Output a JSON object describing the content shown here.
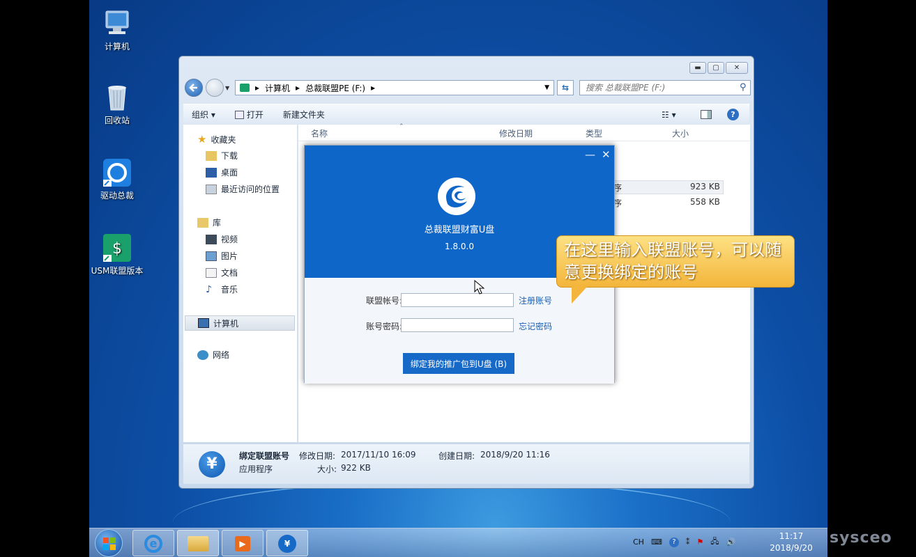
{
  "desktop": {
    "icons": [
      {
        "label": "计算机"
      },
      {
        "label": "回收站"
      },
      {
        "label": "驱动总裁"
      },
      {
        "label": "USM联盟版本"
      }
    ]
  },
  "explorer": {
    "window_controls": {
      "minimize": "▬",
      "maximize": "▢",
      "close": "✕"
    },
    "breadcrumb": [
      "计算机",
      "总裁联盟PE (F:)"
    ],
    "search_placeholder": "搜索 总裁联盟PE (F:)",
    "toolbar": {
      "organize": "组织 ▾",
      "open": "打开",
      "new_folder": "新建文件夹"
    },
    "nav": {
      "favorites": "收藏夹",
      "downloads": "下载",
      "desktop": "桌面",
      "recent": "最近访问的位置",
      "library": "库",
      "videos": "视频",
      "pictures": "图片",
      "documents": "文档",
      "music": "音乐",
      "computer": "计算机",
      "network": "网络"
    },
    "columns": {
      "name": "名称",
      "modified": "修改日期",
      "type": "类型",
      "size": "大小"
    },
    "rows": [
      {
        "type": "序",
        "size": "923 KB"
      },
      {
        "type": "序",
        "size": "558 KB"
      }
    ],
    "details": {
      "file_name": "绑定联盟账号",
      "file_type": "应用程序",
      "modified_label": "修改日期:",
      "modified_value": "2017/11/10 16:09",
      "created_label": "创建日期:",
      "created_value": "2018/9/20 11:16",
      "size_label": "大小:",
      "size_value": "922 KB",
      "icon_glyph": "¥"
    }
  },
  "dialog": {
    "minimize": "—",
    "close": "✕",
    "app_name": "总裁联盟财富U盘",
    "version": "1.8.0.0",
    "account_label": "联盟帐号:",
    "account_value": "",
    "register_link": "注册账号",
    "password_label": "账号密码:",
    "password_value": "",
    "forgot_link": "忘记密码",
    "bind_button": "绑定我的推广包到U盘 (B)"
  },
  "bubble": {
    "text": "在这里输入联盟账号，可以随意更换绑定的账号"
  },
  "taskbar": {
    "tray_lang": "CH",
    "time": "11:17",
    "date": "2018/9/20"
  },
  "watermark": "sysceo",
  "colors": {
    "dialog_blue": "#0e66c9",
    "bubble_orange": "#f3b53b",
    "link_blue": "#1a5fb4"
  }
}
